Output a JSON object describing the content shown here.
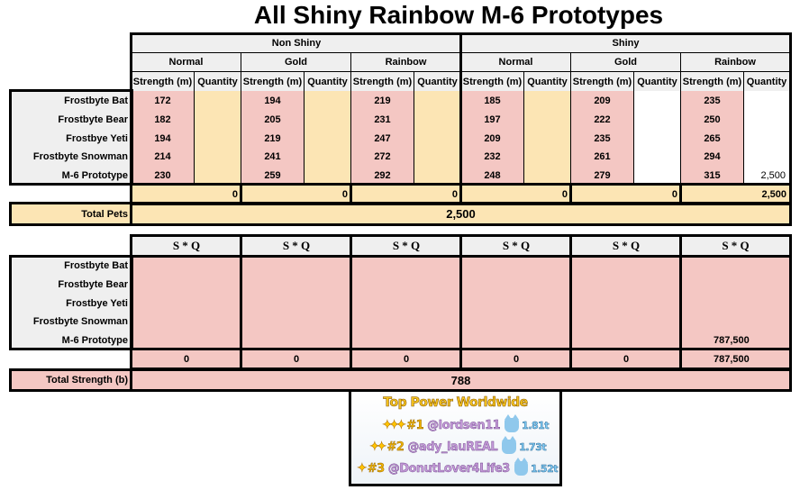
{
  "title": "All Shiny Rainbow M-6 Prototypes",
  "groups": [
    "Non Shiny",
    "Shiny"
  ],
  "variants": [
    "Normal",
    "Gold",
    "Rainbow",
    "Normal",
    "Gold",
    "Rainbow"
  ],
  "subheaders": {
    "strength": "Strength (m)",
    "quantity": "Quantity"
  },
  "pets": [
    "Frostbyte Bat",
    "Frostbyte Bear",
    "Frostbye Yeti",
    "Frostbyte Snowman",
    "M-6 Prototype"
  ],
  "strength": [
    [
      "172",
      "194",
      "219",
      "185",
      "209",
      "235"
    ],
    [
      "182",
      "205",
      "231",
      "197",
      "222",
      "250"
    ],
    [
      "194",
      "219",
      "247",
      "209",
      "235",
      "265"
    ],
    [
      "214",
      "241",
      "272",
      "232",
      "261",
      "294"
    ],
    [
      "230",
      "259",
      "292",
      "248",
      "279",
      "315"
    ]
  ],
  "quantity": [
    [
      "",
      "",
      "",
      "",
      "",
      ""
    ],
    [
      "",
      "",
      "",
      "",
      "",
      ""
    ],
    [
      "",
      "",
      "",
      "",
      "",
      ""
    ],
    [
      "",
      "",
      "",
      "",
      "",
      ""
    ],
    [
      "",
      "",
      "",
      "",
      "",
      "2,500"
    ]
  ],
  "quantity_totals": [
    "0",
    "0",
    "0",
    "0",
    "0",
    "2,500"
  ],
  "total_pets": {
    "label": "Total Pets",
    "value": "2,500"
  },
  "sq_header": "S * Q",
  "sq": [
    [
      "",
      "",
      "",
      "",
      "",
      ""
    ],
    [
      "",
      "",
      "",
      "",
      "",
      ""
    ],
    [
      "",
      "",
      "",
      "",
      "",
      ""
    ],
    [
      "",
      "",
      "",
      "",
      "",
      ""
    ],
    [
      "",
      "",
      "",
      "",
      "",
      "787,500"
    ]
  ],
  "sq_totals": [
    "0",
    "0",
    "0",
    "0",
    "0",
    "787,500"
  ],
  "total_strength": {
    "label": "Total Strength (b)",
    "value": "788"
  },
  "leaderboard": {
    "title": "Top Power Worldwide",
    "entries": [
      {
        "rank": "#1",
        "user": "@lordsen11",
        "power": "1.81t",
        "stars": "✦✦✦"
      },
      {
        "rank": "#2",
        "user": "@ady_lauREAL",
        "power": "1.73t",
        "stars": "✦✦"
      },
      {
        "rank": "#3",
        "user": "@DonutLover4Life3",
        "power": "1.52t",
        "stars": "✦"
      }
    ]
  },
  "colors": {
    "strength_fill": "#f4c7c3",
    "quantity_fill": "#fce5b4",
    "header_fill": "#efefef"
  }
}
